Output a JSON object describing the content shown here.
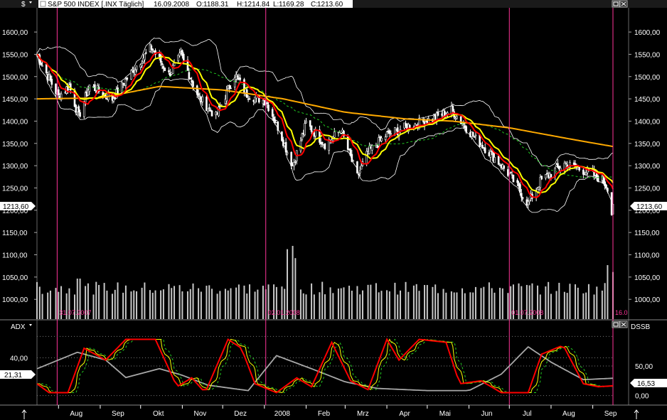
{
  "currency_symbol": "$",
  "header": {
    "instrument": "S&P 500 INDEX [.INX  Täglich]",
    "date": "16.09.2008",
    "open_label": "O:",
    "open": "1188.31",
    "high_label": "H:",
    "high": "1214.84",
    "low_label": "L:",
    "low": "1169.28",
    "close_label": "C:",
    "close": "1213.60"
  },
  "colors": {
    "background": "#000000",
    "candles": "#ffffff",
    "ma_fast": "#ff0000",
    "ma_mid": "#ffff00",
    "ma_slow": "#ffaa00",
    "bollinger": "#ffffff",
    "ma_dashed": "#22cc22",
    "cursor_lines": "#ff3399",
    "volume": "#c8c8c8",
    "header_bg": "#ffffff",
    "open_color": "#ff0000",
    "close_color": "#00aa00"
  },
  "price_panel": {
    "y_ticks": [
      "1600,00",
      "1550,00",
      "1500,00",
      "1450,00",
      "1400,00",
      "1350,00",
      "1300,00",
      "1250,00",
      "1200,00",
      "1150,00",
      "1100,00",
      "1050,00",
      "1000,00"
    ],
    "last_price_left": "1213,60",
    "last_price_right": "1213,60",
    "cursor_date_labels": [
      "31.07.2007",
      "02.01.2008",
      "01.07.2008",
      "16.0"
    ]
  },
  "indicator_panel": {
    "title_left": "ADX",
    "title_right": "DSSB",
    "left_ticks": [
      "40,00"
    ],
    "left_marker": "21,31",
    "right_ticks": [
      "50,00",
      "0,00"
    ],
    "right_marker": "16,53"
  },
  "x_axis": {
    "months": [
      "Aug",
      "Sep",
      "Okt",
      "Nov",
      "Dez",
      "2008",
      "Feb",
      "Mrz",
      "Apr",
      "Mai",
      "Jun",
      "Jul",
      "Aug",
      "Sep"
    ]
  },
  "chart_data": {
    "type": "line",
    "title": "S&P 500 INDEX",
    "x_range": [
      "2007-07-16",
      "2008-09-16"
    ],
    "price_ylim": [
      970,
      1640
    ],
    "price_key_points": [
      [
        "2007-07-16",
        1550
      ],
      [
        "2007-07-26",
        1490
      ],
      [
        "2007-08-01",
        1455
      ],
      [
        "2007-08-09",
        1480
      ],
      [
        "2007-08-16",
        1410
      ],
      [
        "2007-08-24",
        1480
      ],
      [
        "2007-09-10",
        1450
      ],
      [
        "2007-09-28",
        1525
      ],
      [
        "2007-10-09",
        1565
      ],
      [
        "2007-10-22",
        1505
      ],
      [
        "2007-10-31",
        1548
      ],
      [
        "2007-11-13",
        1455
      ],
      [
        "2007-11-26",
        1410
      ],
      [
        "2007-12-10",
        1505
      ],
      [
        "2007-12-19",
        1460
      ],
      [
        "2008-01-02",
        1445
      ],
      [
        "2008-01-10",
        1395
      ],
      [
        "2008-01-22",
        1300
      ],
      [
        "2008-02-01",
        1395
      ],
      [
        "2008-02-15",
        1348
      ],
      [
        "2008-02-27",
        1380
      ],
      [
        "2008-03-10",
        1275
      ],
      [
        "2008-03-18",
        1330
      ],
      [
        "2008-04-01",
        1370
      ],
      [
        "2008-04-18",
        1390
      ],
      [
        "2008-05-05",
        1405
      ],
      [
        "2008-05-19",
        1425
      ],
      [
        "2008-06-06",
        1360
      ],
      [
        "2008-06-20",
        1318
      ],
      [
        "2008-07-01",
        1280
      ],
      [
        "2008-07-15",
        1215
      ],
      [
        "2008-07-24",
        1265
      ],
      [
        "2008-08-11",
        1305
      ],
      [
        "2008-08-29",
        1285
      ],
      [
        "2008-09-08",
        1268
      ],
      [
        "2008-09-12",
        1252
      ],
      [
        "2008-09-15",
        1193
      ],
      [
        "2008-09-16",
        1213.6
      ]
    ],
    "ma_slow_key_points": [
      [
        "2007-07-16",
        1450
      ],
      [
        "2007-09-01",
        1452
      ],
      [
        "2007-10-15",
        1478
      ],
      [
        "2007-12-01",
        1470
      ],
      [
        "2008-01-15",
        1450
      ],
      [
        "2008-03-01",
        1420
      ],
      [
        "2008-04-15",
        1405
      ],
      [
        "2008-05-20",
        1400
      ],
      [
        "2008-07-01",
        1385
      ],
      [
        "2008-08-15",
        1360
      ],
      [
        "2008-09-16",
        1343
      ]
    ],
    "volume_ylim": [
      0,
      800
    ],
    "adx_ylim": [
      0,
      65
    ],
    "adx_ticks": [
      40
    ],
    "dssb_ylim": [
      -10,
      110
    ],
    "dssb_ticks": [
      50,
      0
    ],
    "adx_key_points": [
      [
        "2007-07-16",
        30
      ],
      [
        "2007-08-15",
        45
      ],
      [
        "2007-09-05",
        38
      ],
      [
        "2007-09-20",
        22
      ],
      [
        "2007-10-15",
        30
      ],
      [
        "2007-11-01",
        24
      ],
      [
        "2007-11-20",
        15
      ],
      [
        "2007-12-20",
        10
      ],
      [
        "2008-01-10",
        42
      ],
      [
        "2008-02-05",
        30
      ],
      [
        "2008-03-01",
        18
      ],
      [
        "2008-03-25",
        12
      ],
      [
        "2008-05-01",
        10
      ],
      [
        "2008-06-01",
        10
      ],
      [
        "2008-06-25",
        25
      ],
      [
        "2008-07-15",
        50
      ],
      [
        "2008-08-01",
        36
      ],
      [
        "2008-08-25",
        20
      ],
      [
        "2008-09-16",
        21.31
      ]
    ],
    "dssb_key_points": [
      [
        "2007-07-16",
        20
      ],
      [
        "2007-07-25",
        5
      ],
      [
        "2007-08-08",
        5
      ],
      [
        "2007-08-20",
        80
      ],
      [
        "2007-09-05",
        60
      ],
      [
        "2007-09-20",
        95
      ],
      [
        "2007-10-12",
        95
      ],
      [
        "2007-10-28",
        15
      ],
      [
        "2007-11-08",
        30
      ],
      [
        "2007-11-18",
        5
      ],
      [
        "2007-12-05",
        95
      ],
      [
        "2007-12-15",
        80
      ],
      [
        "2007-12-25",
        20
      ],
      [
        "2008-01-10",
        5
      ],
      [
        "2008-01-25",
        30
      ],
      [
        "2008-02-05",
        15
      ],
      [
        "2008-02-20",
        90
      ],
      [
        "2008-03-05",
        25
      ],
      [
        "2008-03-18",
        10
      ],
      [
        "2008-04-01",
        95
      ],
      [
        "2008-04-10",
        60
      ],
      [
        "2008-04-25",
        95
      ],
      [
        "2008-05-15",
        90
      ],
      [
        "2008-05-25",
        20
      ],
      [
        "2008-06-10",
        25
      ],
      [
        "2008-06-25",
        5
      ],
      [
        "2008-07-15",
        5
      ],
      [
        "2008-07-25",
        70
      ],
      [
        "2008-08-10",
        85
      ],
      [
        "2008-08-25",
        20
      ],
      [
        "2008-09-05",
        15
      ],
      [
        "2008-09-16",
        16.53
      ]
    ]
  }
}
